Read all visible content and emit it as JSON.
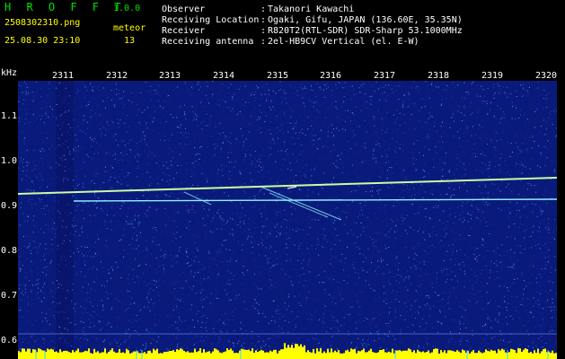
{
  "header": {
    "app_name": "H R O F F T",
    "app_version": "1.0.0",
    "file_name": "2508302310.png",
    "meteor_label": "meteor",
    "datetime": "25.08.30 23:10",
    "meteor_count": "13"
  },
  "info": [
    {
      "label": "Observer",
      "value": "Takanori Kawachi"
    },
    {
      "label": "Receiving Location",
      "value": "Ogaki, Gifu, JAPAN (136.60E, 35.35N)"
    },
    {
      "label": "Receiver",
      "value": "R820T2(RTL-SDR) SDR-Sharp 53.1000MHz"
    },
    {
      "label": "Receiving antenna",
      "value": "2el-HB9CV Vertical (el. E-W)"
    }
  ],
  "axis": {
    "unit": "kHz",
    "time_ticks": [
      "2311",
      "2312",
      "2313",
      "2314",
      "2315",
      "2316",
      "2317",
      "2318",
      "2319",
      "2320"
    ],
    "freq_ticks": [
      "1.1",
      "1.0",
      "0.9",
      "0.8",
      "0.7",
      "0.6"
    ]
  },
  "colors": {
    "background_noise": "#0a1a7a",
    "carrier": "#c8ffa0",
    "header_green": "#00e000",
    "header_yellow": "#ffff00",
    "bottom_band": "#ffff00"
  }
}
